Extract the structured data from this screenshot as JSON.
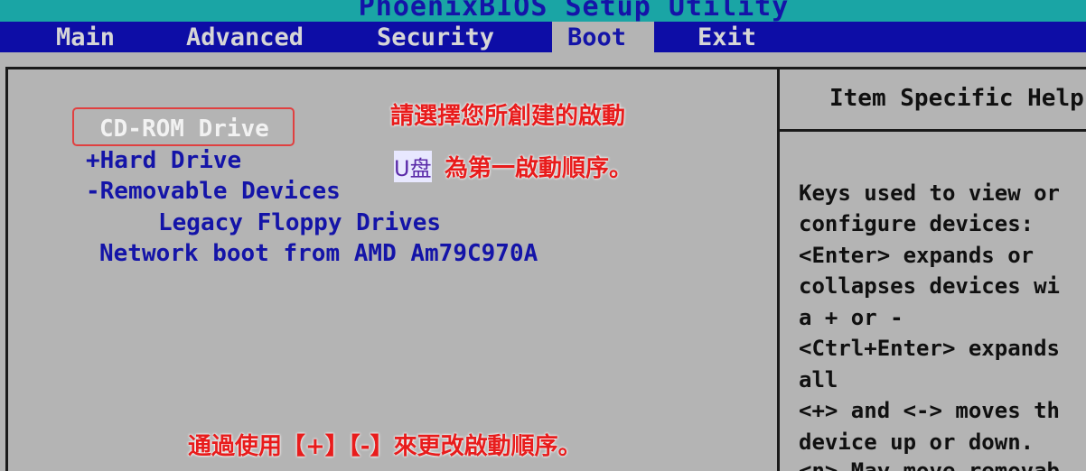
{
  "window": {
    "title": "PhoenixBIOS Setup Utility"
  },
  "menu": {
    "tabs": [
      {
        "label": "Main"
      },
      {
        "label": "Advanced"
      },
      {
        "label": "Security"
      },
      {
        "label": "Boot"
      },
      {
        "label": "Exit"
      }
    ],
    "active_tab": "Boot"
  },
  "boot_order": {
    "items": [
      {
        "label": "CD-ROM Drive",
        "selected": true
      },
      {
        "label": "+Hard Drive",
        "selected": false
      },
      {
        "label": "-Removable Devices",
        "selected": false
      },
      {
        "label": "Legacy Floppy Drives",
        "selected": false
      },
      {
        "label": "Network boot from AMD Am79C970A",
        "selected": false
      }
    ]
  },
  "help": {
    "title": "Item Specific Help",
    "lines": [
      "Keys used to view or",
      "configure devices:",
      "<Enter> expands or",
      "collapses devices wi",
      "a + or -",
      "<Ctrl+Enter> expands",
      "all",
      "<+> and <-> moves th",
      "device up or down.",
      "<n> May move removab"
    ]
  },
  "annotations": {
    "line1": "請選擇您所創建的啟動",
    "line2_prefix": "U盘",
    "line2_rest": "為第一啟動順序。",
    "bottom": "通過使用【+】【-】來更改啟動順序。"
  },
  "colors": {
    "title_bar": "#1aa5a5",
    "menu_bar": "#0d0da6",
    "panel": "#b4b4b4",
    "item_text": "#1414a8",
    "annotation_red": "#e81c1c",
    "highlight_box": "#e04040"
  }
}
